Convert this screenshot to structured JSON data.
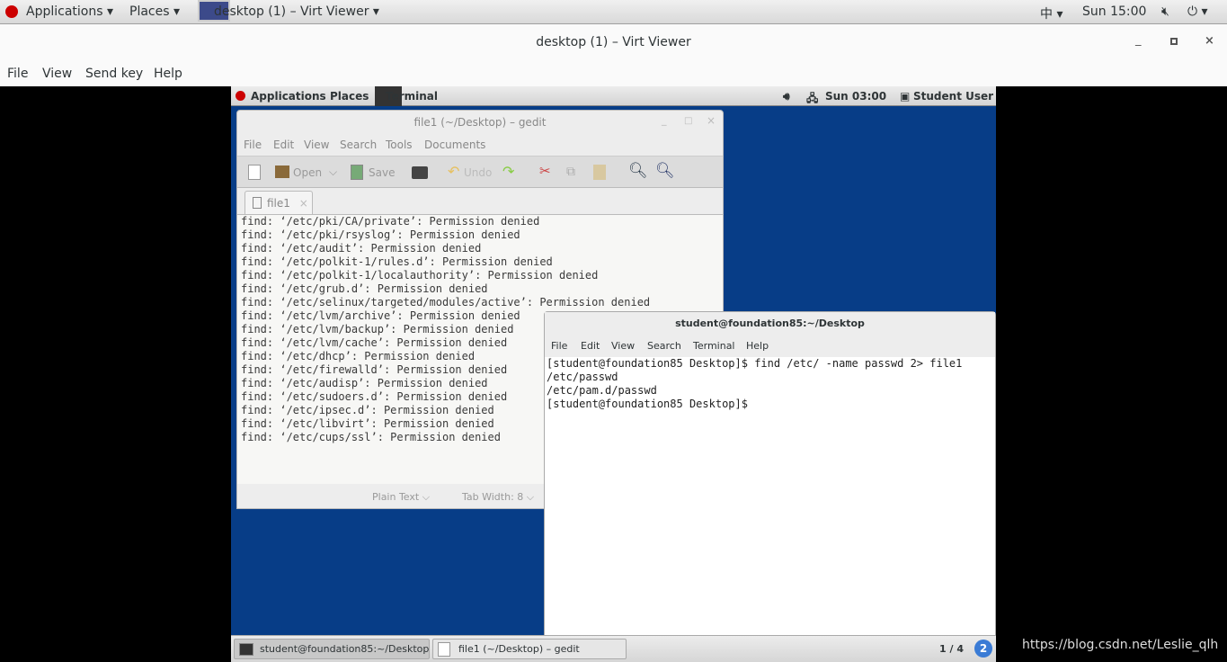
{
  "host": {
    "top_bar": {
      "applications": "Applications ▾",
      "places": "Places ▾",
      "window": "desktop (1) – Virt Viewer ▾",
      "input": "中 ▾",
      "clock": "Sun 15:00",
      "power": "⏻ ▾"
    },
    "title": "desktop (1) – Virt Viewer",
    "menu": [
      "File",
      "View",
      "Send key",
      "Help"
    ]
  },
  "vm": {
    "top_bar": {
      "applications": "Applications",
      "places": "Places",
      "terminal": "Terminal",
      "clock": "Sun 03:00",
      "user": "Student User"
    },
    "gedit": {
      "title": "file1 (~/Desktop) – gedit",
      "menu": [
        "File",
        "Edit",
        "View",
        "Search",
        "Tools",
        "Documents"
      ],
      "toolbar": {
        "open": "Open",
        "save": "Save",
        "undo": "Undo"
      },
      "tab": "file1",
      "lines": [
        "find: ‘/etc/pki/CA/private’: Permission denied",
        "find: ‘/etc/pki/rsyslog’: Permission denied",
        "find: ‘/etc/audit’: Permission denied",
        "find: ‘/etc/polkit-1/rules.d’: Permission denied",
        "find: ‘/etc/polkit-1/localauthority’: Permission denied",
        "find: ‘/etc/grub.d’: Permission denied",
        "find: ‘/etc/selinux/targeted/modules/active’: Permission denied",
        "find: ‘/etc/lvm/archive’: Permission denied",
        "find: ‘/etc/lvm/backup’: Permission denied",
        "find: ‘/etc/lvm/cache’: Permission denied",
        "find: ‘/etc/dhcp’: Permission denied",
        "find: ‘/etc/firewalld’: Permission denied",
        "find: ‘/etc/audisp’: Permission denied",
        "find: ‘/etc/sudoers.d’: Permission denied",
        "find: ‘/etc/ipsec.d’: Permission denied",
        "find: ‘/etc/libvirt’: Permission denied",
        "find: ‘/etc/cups/ssl’: Permission denied"
      ],
      "status": {
        "language": "Plain Text ⌵",
        "tab_width": "Tab Width:  8 ⌵"
      }
    },
    "terminal": {
      "title": "student@foundation85:~/Desktop",
      "menu": [
        "File",
        "Edit",
        "View",
        "Search",
        "Terminal",
        "Help"
      ],
      "lines": [
        "[student@foundation85 Desktop]$ find /etc/ -name passwd 2> file1",
        "/etc/passwd",
        "/etc/pam.d/passwd",
        "[student@foundation85 Desktop]$ "
      ]
    },
    "taskbar": {
      "items": [
        "student@foundation85:~/Desktop",
        "file1 (~/Desktop) – gedit"
      ],
      "workspace": "1 / 4",
      "badge": "2"
    },
    "desktop_color": "#073d87"
  },
  "watermark": "https://blog.csdn.net/Leslie_qlh"
}
